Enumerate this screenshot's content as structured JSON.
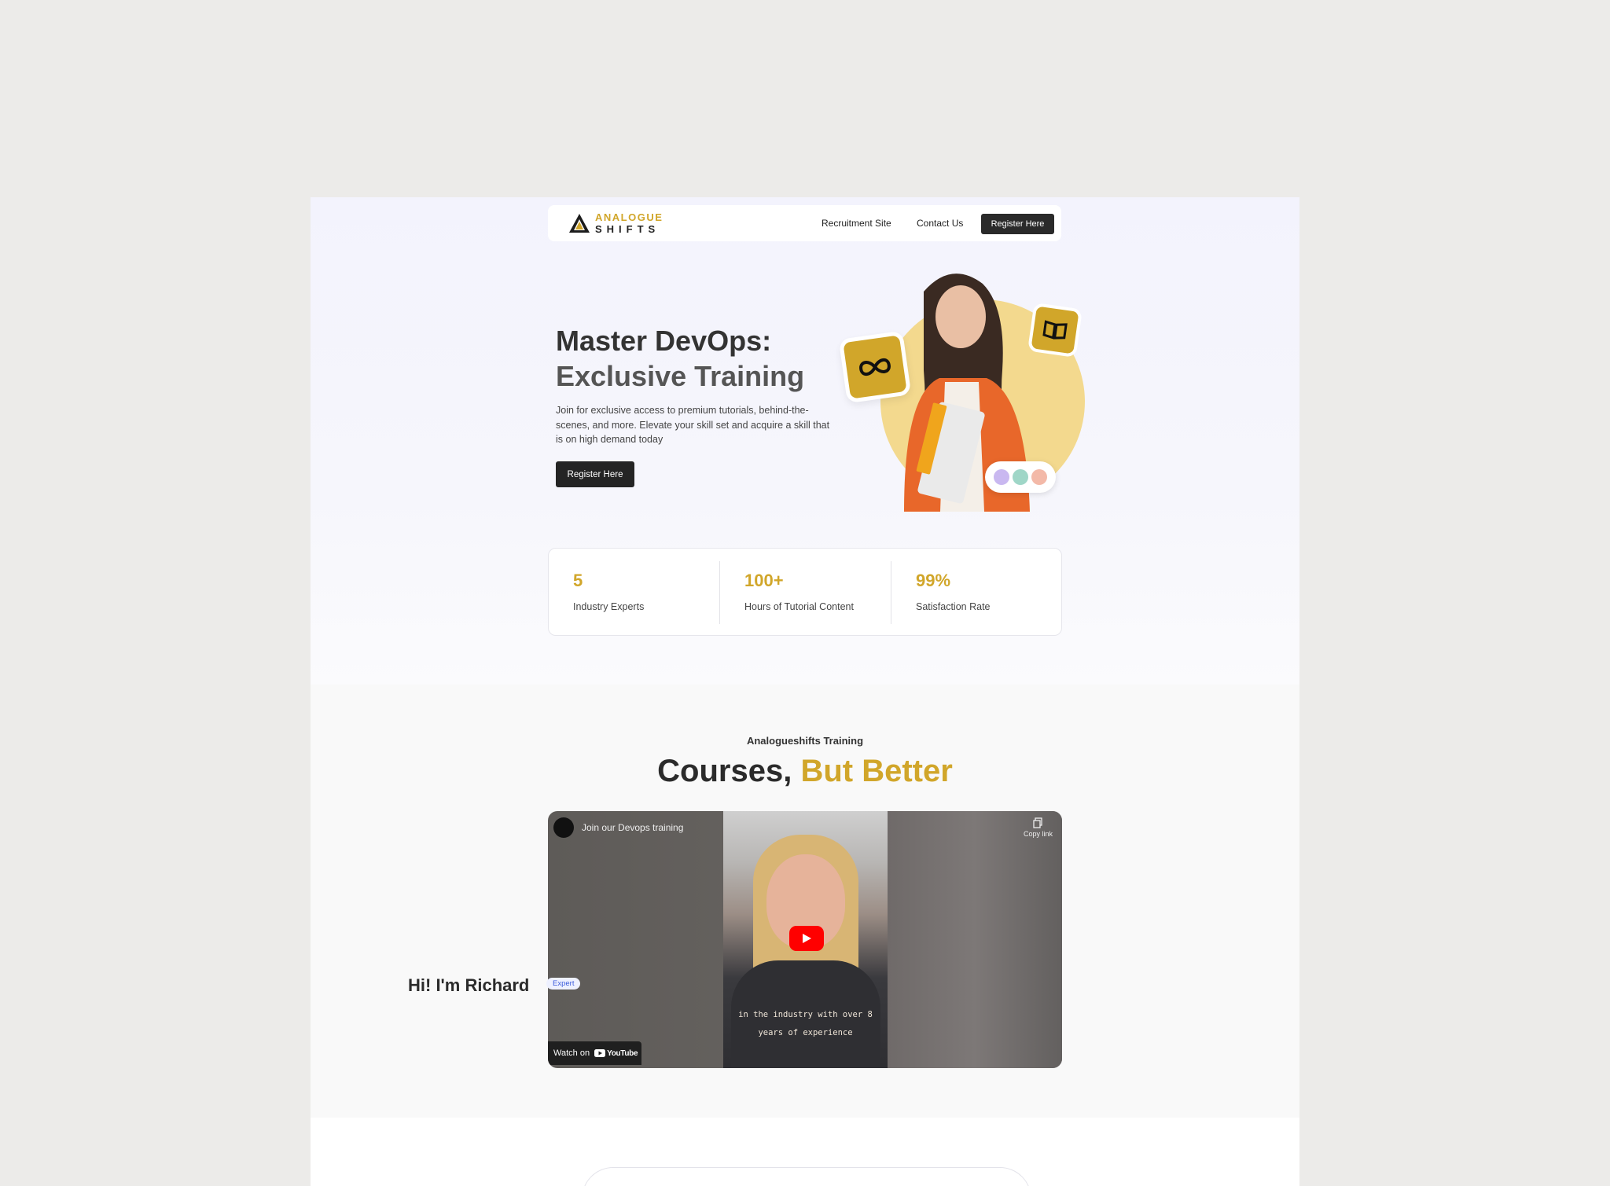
{
  "brand": {
    "top": "ANALOGUE",
    "bottom": "SHIFTS",
    "accent": "#d1a62a"
  },
  "nav": {
    "recruitment": "Recruitment Site",
    "contact": "Contact Us",
    "register": "Register Here"
  },
  "hero": {
    "title_line1": "Master DevOps:",
    "title_line2": "Exclusive Training",
    "description": "Join for exclusive access to premium tutorials, behind-the-scenes, and more. Elevate your skill set and acquire a skill that is on high demand today",
    "cta": "Register Here"
  },
  "stats": [
    {
      "value": "5",
      "label": "Industry Experts"
    },
    {
      "value": "100+",
      "label": "Hours of Tutorial Content"
    },
    {
      "value": "99%",
      "label": "Satisfaction Rate"
    }
  ],
  "courses": {
    "eyebrow": "Analogueshifts Training",
    "title_main": "Courses,",
    "title_accent": "But Better"
  },
  "video": {
    "title": "Join our Devops training",
    "copy_link": "Copy link",
    "watch_on": "Watch on",
    "youtube": "YouTube",
    "caption_line1": "in the industry with over 8",
    "caption_line2": "years of experience"
  },
  "bio": {
    "title": "Hi! I'm Richard",
    "badge": "Expert"
  }
}
